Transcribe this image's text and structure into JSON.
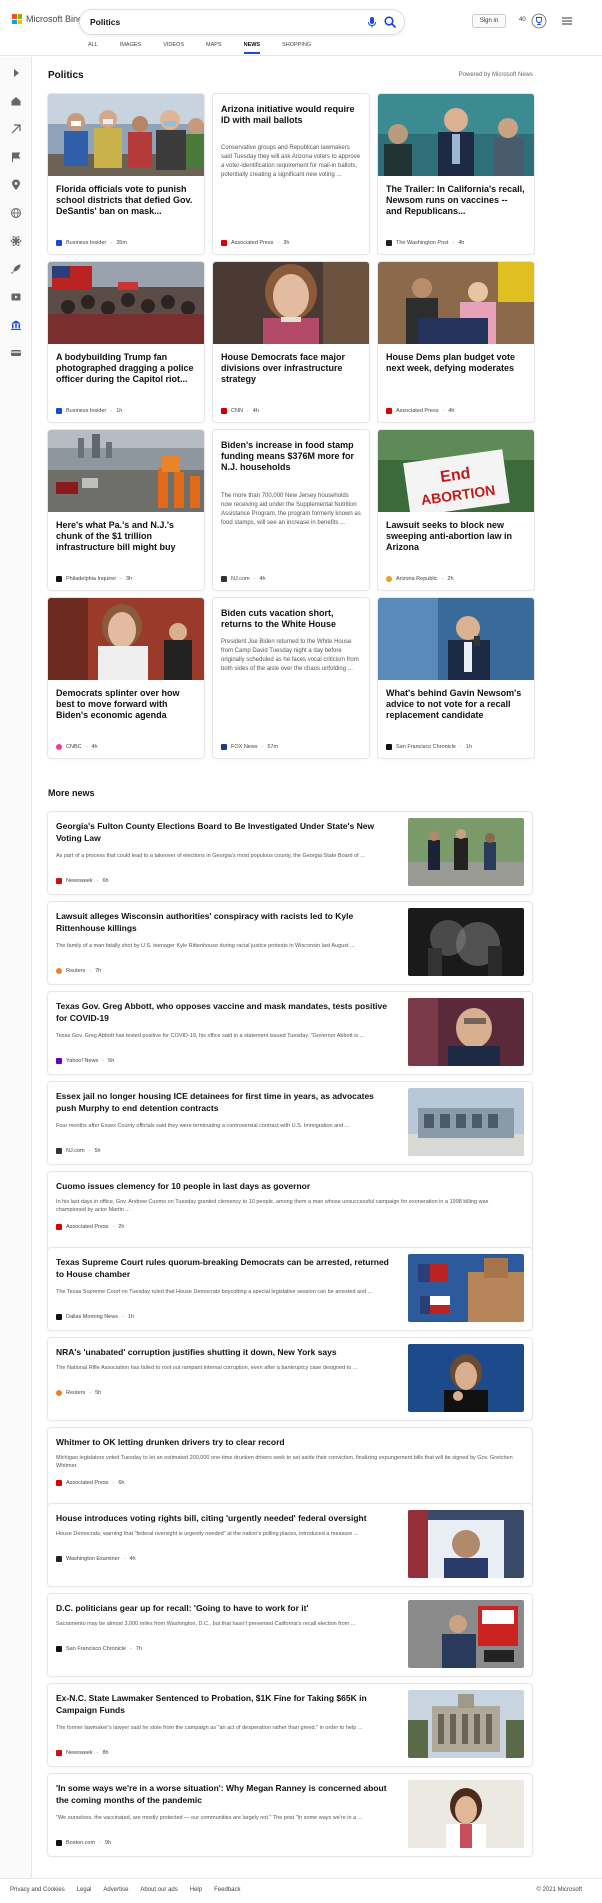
{
  "header": {
    "logo_text": "Microsoft Bing",
    "search_value": "Politics",
    "signin_label": "Sign in",
    "rewards_count": "40",
    "tabs": [
      {
        "label": "ALL",
        "active": false
      },
      {
        "label": "IMAGES",
        "active": false
      },
      {
        "label": "VIDEOS",
        "active": false
      },
      {
        "label": "MAPS",
        "active": false
      },
      {
        "label": "NEWS",
        "active": true
      },
      {
        "label": "SHOPPING",
        "active": false
      }
    ]
  },
  "section_title": "Politics",
  "powered_by": "Powered by Microsoft News",
  "cards": [
    {
      "title": "Florida officials vote to punish school districts that defied Gov. DeSantis' ban on mask...",
      "source": "Business Insider",
      "time": "35m",
      "has_image": true
    },
    {
      "title": "Arizona initiative would require ID with mail ballots",
      "description": "Conservative groups and Republican lawmakers said Tuesday they will ask Arizona voters to approve a voter-identification requirement for mail-in ballots, potentially creating a significant new voting ...",
      "source": "Associated Press",
      "time": "3h",
      "has_image": false
    },
    {
      "title": "The Trailer: In California's recall, Newsom runs on vaccines -- and Republicans...",
      "source": "The Washington Post",
      "time": "4h",
      "has_image": true
    },
    {
      "title": "A bodybuilding Trump fan photographed dragging a police officer during the Capitol riot...",
      "source": "Business Insider",
      "time": "1h",
      "has_image": true
    },
    {
      "title": "House Democrats face major divisions over infrastructure strategy",
      "source": "CNN",
      "time": "4h",
      "has_image": true
    },
    {
      "title": "House Dems plan budget vote next week, defying moderates",
      "source": "Associated Press",
      "time": "4h",
      "has_image": true
    },
    {
      "title": "Here's what Pa.'s and N.J.'s chunk of the $1 trillion infrastructure bill might buy",
      "source": "Philadelphia Inquirer",
      "time": "3h",
      "has_image": true
    },
    {
      "title": "Biden's increase in food stamp funding means $376M more for N.J. households",
      "description": "The more than 700,000 New Jersey households now receiving aid under the Supplemental Nutrition Assistance Program, the program formerly known as food stamps, will see an increase in benefits ...",
      "source": "NJ.com",
      "time": "4h",
      "has_image": false
    },
    {
      "title": "Lawsuit seeks to block new sweeping anti-abortion law in Arizona",
      "source": "Arizona Republic",
      "time": "2h",
      "has_image": true
    },
    {
      "title": "Democrats splinter over how best to move forward with Biden's economic agenda",
      "source": "CNBC",
      "time": "4h",
      "has_image": true
    },
    {
      "title": "Biden cuts vacation short, returns to the White House",
      "description": "President Joe Biden returned to the White House from Camp David Tuesday night a day before originally scheduled as he faces vocal criticism from both sides of the aisle over the chaos unfolding ...",
      "source": "FOX News",
      "time": "57m",
      "has_image": false
    },
    {
      "title": "What's behind Gavin Newsom's advice to not vote for a recall replacement candidate",
      "source": "San Francisco Chronicle",
      "time": "1h",
      "has_image": true
    }
  ],
  "more_news_title": "More news",
  "more_news": [
    {
      "title": "Georgia's Fulton County Elections Board to Be Investigated Under State's New Voting Law",
      "description": "As part of a process that could lead to a takeover of elections in Georgia's most populous county, the Georgia State Board of ...",
      "source": "Newsweek",
      "time": "6h",
      "has_image": true
    },
    {
      "title": "Lawsuit alleges Wisconsin authorities' conspiracy with racists led to Kyle Rittenhouse killings",
      "description": "The family of a man fatally shot by U.S. teenager Kyle Rittenhouse during racial justice protests in Wisconsin last August ...",
      "source": "Reuters",
      "time": "7h",
      "has_image": true
    },
    {
      "title": "Texas Gov. Greg Abbott, who opposes vaccine and mask mandates, tests positive for COVID-19",
      "description": "Texas Gov. Greg Abbott has tested positive for COVID-19, his office said in a statement issued Tuesday. \"Governor Abbott is ...",
      "source": "Yahoo! News",
      "time": "5h",
      "has_image": true
    },
    {
      "title": "Essex jail no longer housing ICE detainees for first time in years, as advocates push Murphy to end detention contracts",
      "description": "Four months after Essex County officials said they were terminating a controversial contract with U.S. Immigration and ...",
      "source": "NJ.com",
      "time": "5h",
      "has_image": true
    },
    {
      "title": "Cuomo issues clemency for 10 people in last days as governor",
      "description": "In his last days in office, Gov. Andrew Cuomo on Tuesday granted clemency to 10 people, among them a man whose unsuccessful campaign for exoneration in a 1998 killing was championed by actor Martin ...",
      "source": "Associated Press",
      "time": "2h",
      "has_image": false
    },
    {
      "title": "Texas Supreme Court rules quorum-breaking Democrats can be arrested, returned to House chamber",
      "description": "The Texas Supreme Court on Tuesday ruled that House Democrats boycotting a special legislative session can be arrested and ...",
      "source": "Dallas Morning News",
      "time": "1h",
      "has_image": true
    },
    {
      "title": "NRA's 'unabated' corruption justifies shutting it down, New York says",
      "description": "The National Rifle Association has failed to root out rampant internal corruption, even after a bankruptcy case designed to ...",
      "source": "Reuters",
      "time": "5h",
      "has_image": true
    },
    {
      "title": "Whitmer to OK letting drunken drivers try to clear record",
      "description": "Michigan legislators voted Tuesday to let an estimated 200,000 one-time drunken drivers seek to set aside their conviction, finalizing expungement bills that will be signed by Gov. Gretchen Whitmer.",
      "source": "Associated Press",
      "time": "6h",
      "has_image": false
    },
    {
      "title": "House introduces voting rights bill, citing 'urgently needed' federal oversight",
      "description": "House Democrats, warning that \"federal oversight is urgently needed\" at the nation's polling places, introduced a measure ...",
      "source": "Washington Examiner",
      "time": "4h",
      "has_image": true
    },
    {
      "title": "D.C. politicians gear up for recall: 'Going to have to work for it'",
      "description": "Sacramento may be almost 3,000 miles from Washington, D.C., but that hasn't prevented California's recall election from ...",
      "source": "San Francisco Chronicle",
      "time": "7h",
      "has_image": true
    },
    {
      "title": "Ex-N.C. State Lawmaker Sentenced to Probation, $1K Fine for Taking $65K in Campaign Funds",
      "description": "The former lawmaker's lawyer said he stole from the campaign as \"an act of desperation rather than greed,\" in order to help ...",
      "source": "Newsweek",
      "time": "8h",
      "has_image": true
    },
    {
      "title": "'In some ways we're in a worse situation': Why Megan Ranney is concerned about the coming months of the pandemic",
      "description": "\"We ourselves, the vaccinated, are mostly protected — our communities are largely not.\" The post \"In some ways we're in a ...",
      "source": "Boston.com",
      "time": "9h",
      "has_image": true
    }
  ],
  "footer": {
    "links": [
      "Privacy and Cookies",
      "Legal",
      "Advertise",
      "About our ads",
      "Help",
      "Feedback"
    ],
    "copyright": "© 2021 Microsoft"
  }
}
